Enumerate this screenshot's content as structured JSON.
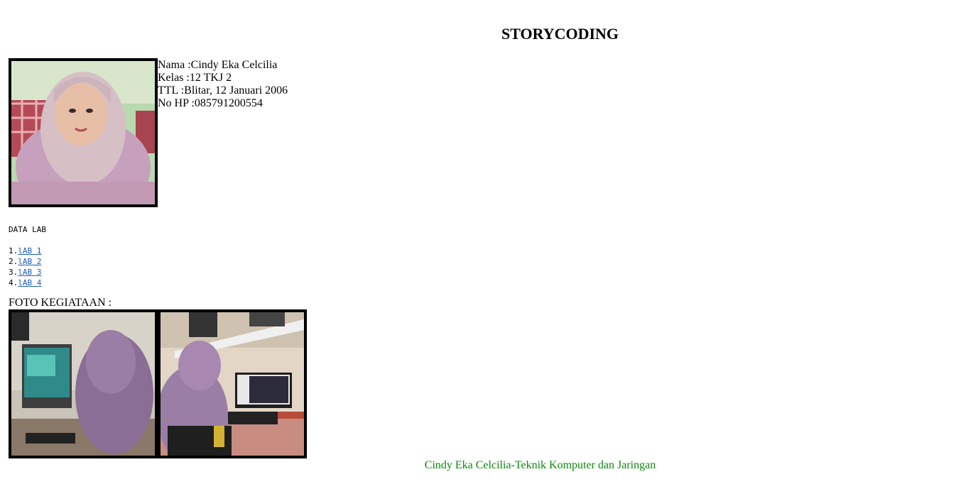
{
  "page": {
    "title": "STORYCODING"
  },
  "profile": {
    "photo_icon": "profile-photo",
    "lines": [
      {
        "label": "Nama :",
        "value": "Cindy Eka Celcilia"
      },
      {
        "label": "Kelas :",
        "value": "12 TKJ 2"
      },
      {
        "label": "TTL :",
        "value": "Blitar, 12 Januari 2006"
      },
      {
        "label": "No HP :",
        "value": "085791200554"
      }
    ]
  },
  "lab": {
    "title": "DATA LAB",
    "items": [
      {
        "num": "1.",
        "label": "lAB 1"
      },
      {
        "num": "2.",
        "label": "lAB 2"
      },
      {
        "num": "3.",
        "label": "lAB 3"
      },
      {
        "num": "4.",
        "label": "lAB 4"
      }
    ]
  },
  "foto": {
    "label": "FOTO KEGIATAAN :"
  },
  "footer": {
    "text": "Cindy Eka Celcilia-Teknik Komputer dan Jaringan",
    "color": "#0a8a0a"
  },
  "colors": {
    "link": "#1a5fb4",
    "frame": "#000000"
  }
}
